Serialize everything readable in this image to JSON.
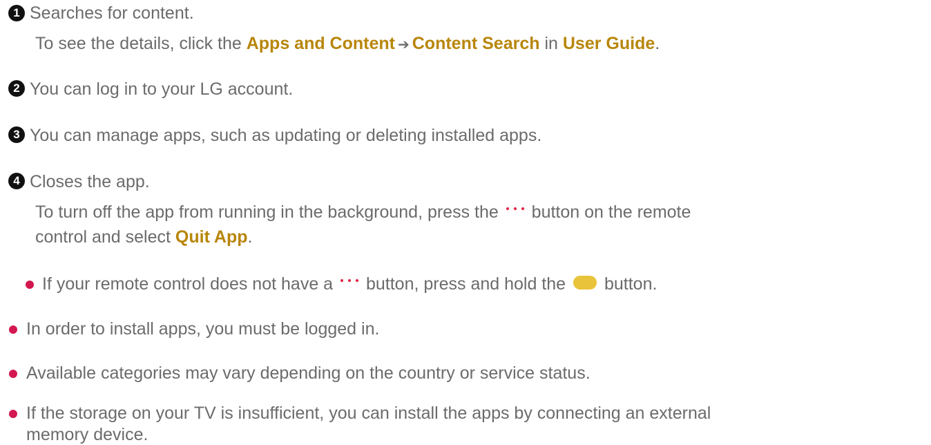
{
  "items": [
    {
      "number": "1",
      "line1": "Searches for content.",
      "line2_prefix": "To see the details, click the ",
      "link1": "Apps and Content",
      "arrow": "➔",
      "link2": "Content Search",
      "middle": " in ",
      "link3": "User Guide",
      "suffix": "."
    },
    {
      "number": "2",
      "line1": "You can log in to your LG account."
    },
    {
      "number": "3",
      "line1": "You can manage apps, such as updating or deleting installed apps."
    },
    {
      "number": "4",
      "line1": "Closes the app.",
      "line2_prefix": "To turn off the app from running in the background, press the ",
      "line2_suffix": " button on the remote",
      "line3_prefix": "control and select ",
      "link": "Quit App",
      "suffix": ".",
      "sub_note_prefix": "If your remote control does not have a ",
      "sub_note_middle": " button, press and hold the ",
      "sub_note_suffix": " button."
    }
  ],
  "notes": [
    "In order to install apps, you must be logged in.",
    "Available categories may vary depending on the country or service status.",
    "If the storage on your TV is insufficient, you can install the apps by connecting an external",
    "memory device."
  ],
  "icons": {
    "more_button": "three-dots-icon",
    "yellow_button": "yellow-color-button-icon"
  },
  "colors": {
    "text": "#6b6b6b",
    "highlight": "#b8860b",
    "bullet": "#d3174f",
    "dots": "#e5203e",
    "yellow_button": "#e9c33a",
    "number_badge": "#111111"
  }
}
